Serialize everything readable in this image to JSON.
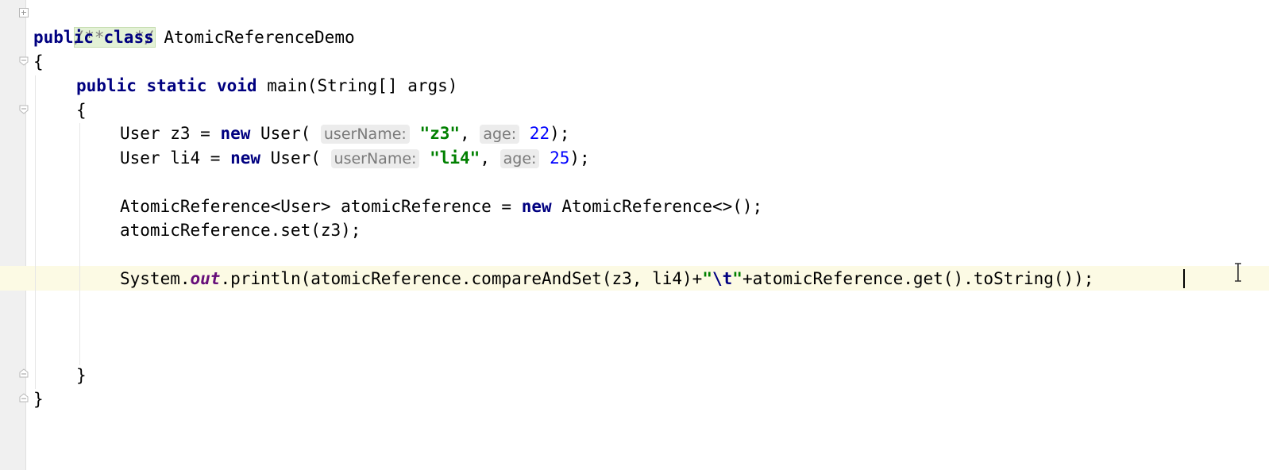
{
  "editor": {
    "folded_comment": "/**...*/",
    "class_decl": {
      "modifier": "public",
      "keyword": "class",
      "name": "AtomicReferenceDemo"
    },
    "class_open_brace": "{",
    "class_close_brace": "}",
    "main_decl": {
      "modifiers": "public static void",
      "rest": "main(String[] args)"
    },
    "main_open_brace": "{",
    "main_close_brace": "}",
    "line_z3": {
      "prefix": "User z3 = ",
      "kw_new": "new",
      "call": " User(",
      "hint_name": "userName:",
      "string_value": "\"z3\"",
      "sep": ",",
      "hint_age": "age:",
      "age_value": "22",
      "suffix": ");"
    },
    "line_li4": {
      "prefix": "User li4 = ",
      "kw_new": "new",
      "call": " User(",
      "hint_name": "userName:",
      "string_value": "\"li4\"",
      "sep": ",",
      "hint_age": "age:",
      "age_value": "25",
      "suffix": ");"
    },
    "line_atomic_decl": {
      "prefix": "AtomicReference<User> atomicReference = ",
      "kw_new": "new",
      "suffix": " AtomicReference<>();"
    },
    "line_set": "atomicReference.set(z3);",
    "line_println": {
      "system": "System.",
      "out": "out",
      "mid": ".println(atomicReference.compareAndSet(z3, li4)+",
      "quote_open": "\"",
      "escape": "\\t",
      "quote_close": "\"",
      "tail": "+atomicReference.get().toString());"
    }
  },
  "colors": {
    "keyword": "#000080",
    "string": "#008000",
    "number": "#0000ff",
    "static_field": "#660e7a",
    "caret_line": "#fcfae4",
    "gutter": "#f0f0f0"
  }
}
